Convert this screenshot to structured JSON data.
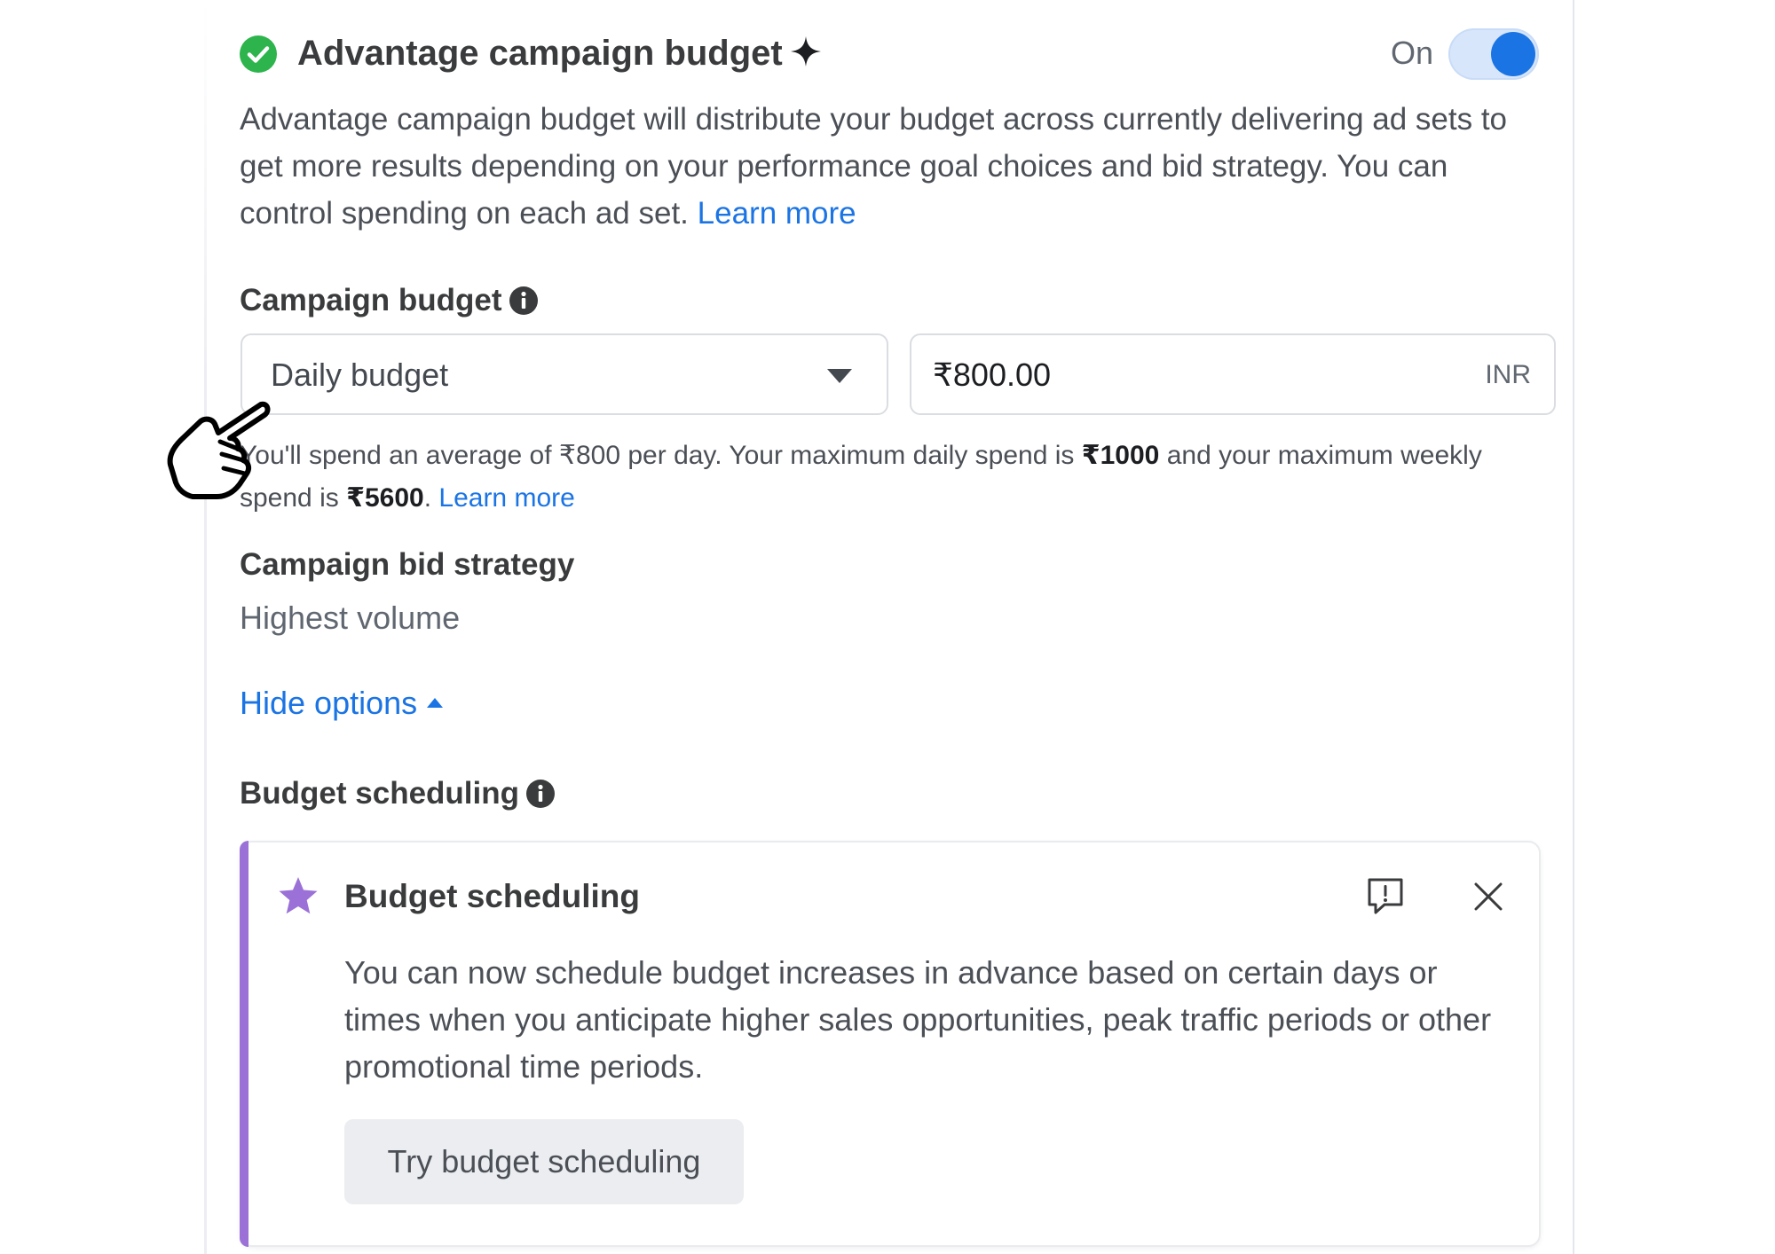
{
  "header": {
    "title": "Advantage campaign budget",
    "toggle_label": "On",
    "toggle_state": "on",
    "icons": {
      "status": "check-circle-icon",
      "ai": "sparkle-icon"
    }
  },
  "description": {
    "text": "Advantage campaign budget will distribute your budget across currently delivering ad sets to get more results depending on your performance goal choices and bid strategy. You can control spending on each ad set.",
    "link": "Learn more"
  },
  "campaign_budget": {
    "label": "Campaign budget",
    "type_select": {
      "value": "Daily budget"
    },
    "amount": {
      "value": "₹800.00",
      "currency": "INR"
    }
  },
  "spend_info": {
    "part1": "You'll spend an average of ₹800 per day. Your maximum daily spend is ",
    "max_daily": "₹1000",
    "part2": " and your maximum weekly spend is ",
    "max_weekly": "₹5600",
    "part3": ".",
    "link": "Learn more"
  },
  "bid_strategy": {
    "label": "Campaign bid strategy",
    "value": "Highest volume"
  },
  "hide_options": "Hide options",
  "budget_scheduling": {
    "label": "Budget scheduling",
    "card": {
      "title": "Budget scheduling",
      "body": "You can now schedule budget increases in advance based on certain days or times when you anticipate higher sales opportunities, peak traffic periods or other promotional time periods.",
      "button": "Try budget scheduling"
    }
  },
  "colors": {
    "accent_blue": "#1b74e4",
    "success_green": "#2db44c",
    "card_accent_purple": "#9b71d8"
  }
}
